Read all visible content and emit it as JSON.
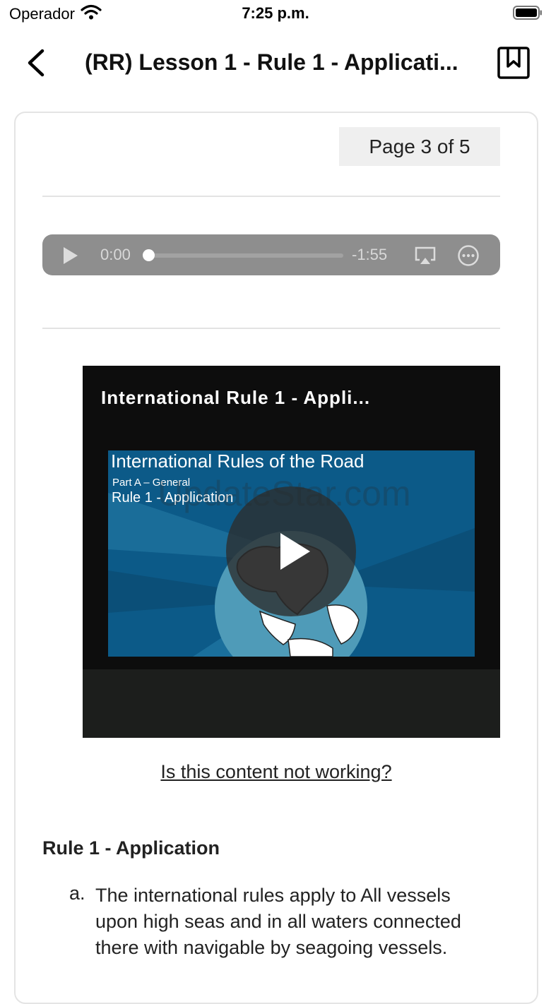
{
  "status_bar": {
    "carrier": "Operador",
    "time": "7:25 p.m."
  },
  "nav": {
    "title": "(RR) Lesson 1 - Rule 1 - Applicati..."
  },
  "page_indicator": "Page 3 of 5",
  "audio": {
    "current_time": "0:00",
    "remaining_time": "-1:55",
    "progress": 0
  },
  "video": {
    "title": "International Rule 1 - Appli...",
    "thumbnail": {
      "heading": "International Rules of the Road",
      "subheading": "Part A – General",
      "caption": "Rule 1 - Application",
      "watermark": "UpdateStar.com"
    }
  },
  "help_link": "Is this content not working?",
  "section": {
    "heading": "Rule 1 - Application",
    "items": [
      {
        "marker": "a.",
        "text": "The international rules apply to All vessels upon high seas and in all waters connected there with navigable by seagoing vessels."
      }
    ]
  },
  "colors": {
    "audio_bg": "#8e8e8e",
    "video_bg": "#0d0d0d",
    "thumbnail_blue": "#0c5a88"
  }
}
